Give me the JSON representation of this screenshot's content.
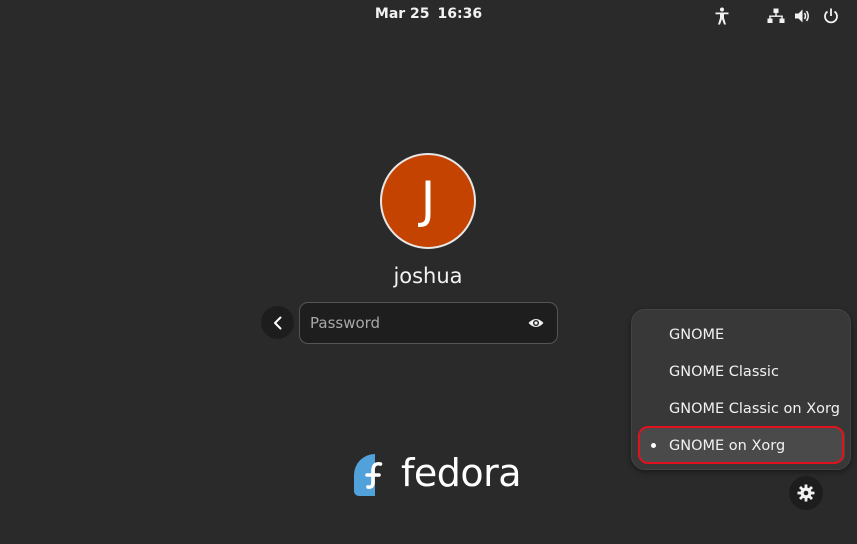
{
  "topbar": {
    "date": "Mar 25",
    "time": "16:36",
    "icons": [
      "accessibility-icon",
      "network-wired-icon",
      "volume-icon",
      "power-icon"
    ]
  },
  "user": {
    "initial": "J",
    "name": "joshua",
    "avatar_color": "#c44300"
  },
  "password": {
    "placeholder": "Password",
    "value": ""
  },
  "logo": {
    "text": "fedora",
    "mark_color": "#3c6eb4"
  },
  "session_menu": {
    "items": [
      {
        "label": "GNOME",
        "selected": false
      },
      {
        "label": "GNOME Classic",
        "selected": false
      },
      {
        "label": "GNOME Classic on Xorg",
        "selected": false
      },
      {
        "label": "GNOME on Xorg",
        "selected": true
      }
    ],
    "highlight_color": "#e0121d"
  }
}
